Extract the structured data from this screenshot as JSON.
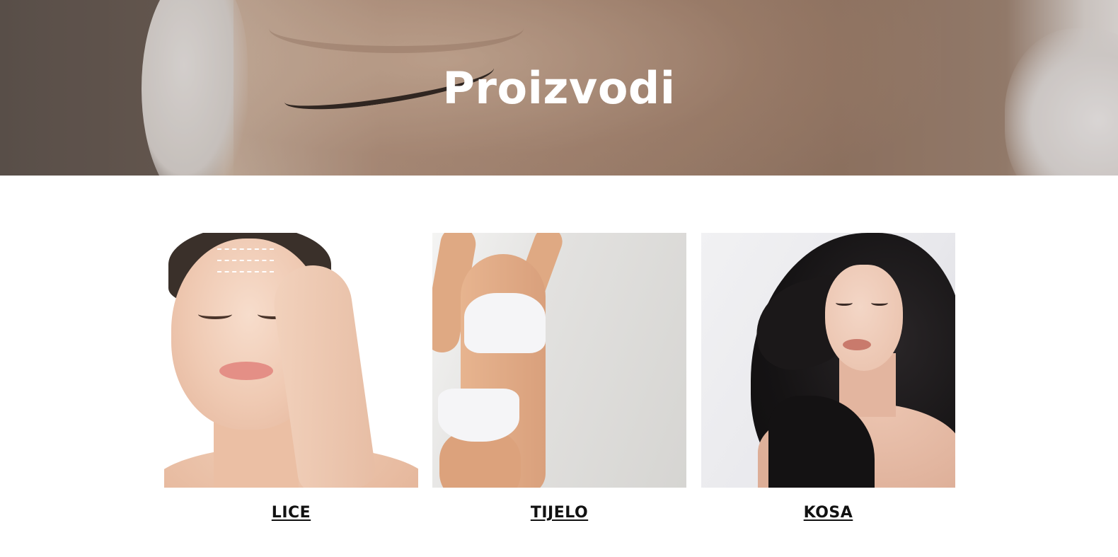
{
  "hero": {
    "title": "Proizvodi"
  },
  "categories": [
    {
      "label": "LICE",
      "image": "face-care-photo"
    },
    {
      "label": "TIJELO",
      "image": "body-care-photo"
    },
    {
      "label": "KOSA",
      "image": "hair-care-photo"
    }
  ]
}
